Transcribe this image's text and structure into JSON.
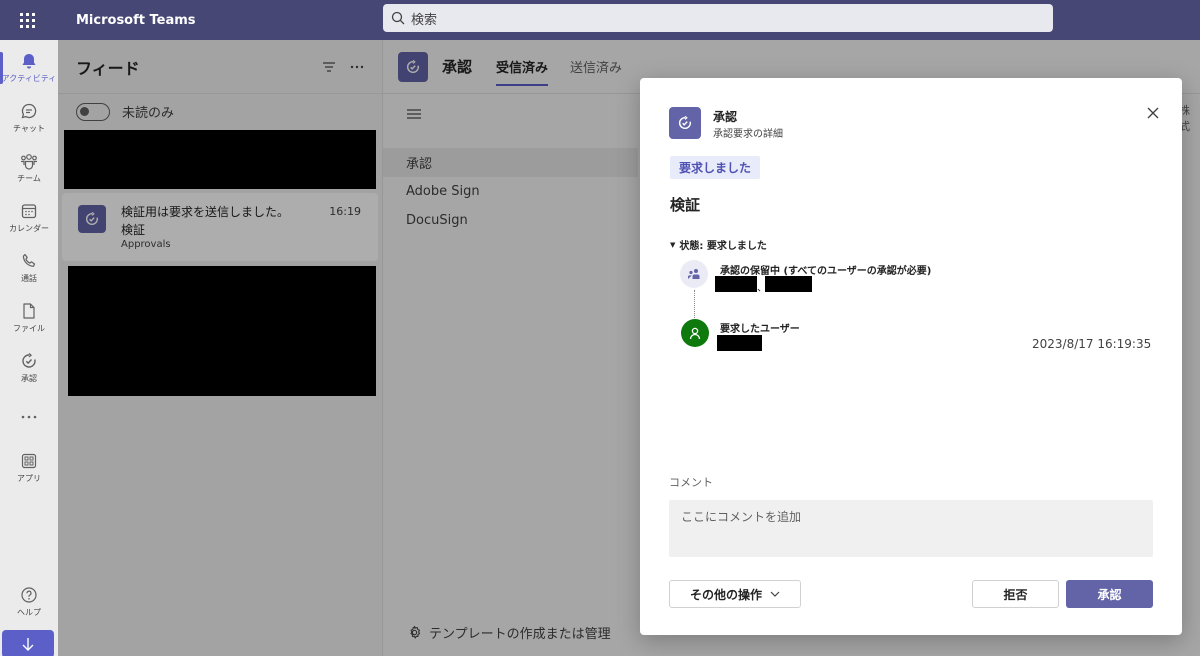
{
  "topbar": {
    "app_name": "Microsoft Teams",
    "search_placeholder": "検索"
  },
  "rail": {
    "items": [
      {
        "label": "アクティビティ",
        "icon": "bell-icon"
      },
      {
        "label": "チャット",
        "icon": "chat-icon"
      },
      {
        "label": "チーム",
        "icon": "teams-icon"
      },
      {
        "label": "カレンダー",
        "icon": "calendar-icon"
      },
      {
        "label": "通話",
        "icon": "phone-icon"
      },
      {
        "label": "ファイル",
        "icon": "file-icon"
      },
      {
        "label": "承認",
        "icon": "approvals-icon"
      },
      {
        "label": "",
        "icon": "more-icon"
      },
      {
        "label": "アプリ",
        "icon": "apps-icon"
      },
      {
        "label": "ヘルプ",
        "icon": "help-icon"
      }
    ],
    "download_icon": "download-arrow-icon"
  },
  "feed": {
    "title": "フィード",
    "toggle_label": "未読のみ",
    "item": {
      "line1": "検証用は要求を送信しました。",
      "line2": "検証",
      "line3": "Approvals",
      "time": "16:19"
    }
  },
  "app": {
    "title": "承認",
    "tabs": [
      "受信済み",
      "送信済み"
    ],
    "nav": [
      "承認",
      "Adobe Sign",
      "DocuSign"
    ],
    "templates_label": "テンプレートの作成または管理",
    "edge_text": "株式"
  },
  "dialog": {
    "title": "承認",
    "subtitle": "承認要求の詳細",
    "status_badge": "要求しました",
    "request_title": "検証",
    "state_label": "状態: 要求しました",
    "pending_label": "承認の保留中 (すべてのユーザーの承認が必要)",
    "pending_separator": "、",
    "requester_label": "要求したユーザー",
    "timestamp": "2023/8/17 16:19:35",
    "comment_label": "コメント",
    "comment_placeholder": "ここにコメントを追加",
    "more_actions": "その他の操作",
    "reject": "拒否",
    "approve": "承認"
  },
  "colors": {
    "brand": "#464775",
    "accent": "#6264a7",
    "requester_avatar": "#0e7a0d"
  }
}
